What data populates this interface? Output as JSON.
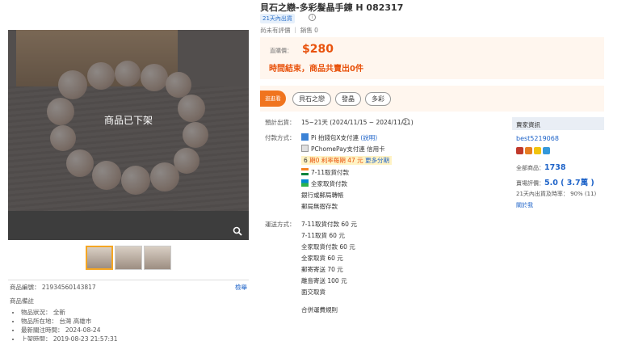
{
  "product": {
    "title": "貝石之戀-多彩髮晶手鍊 H 082317",
    "badge": "21天內出貨",
    "ratings": "尚未有評價 ｜ 銷售 0",
    "price_label": "直購價：",
    "price": "$280",
    "ended": "時間結束，商品共賣出0件"
  },
  "image": {
    "offline_text": "商品已下架"
  },
  "tags": {
    "flag": "逛逛看",
    "items": [
      "貝石之戀",
      "發晶",
      "多彩"
    ]
  },
  "shipping": {
    "label": "預計出貨：",
    "value": "15~21天 (2024/11/15 ~ 2024/11/21)"
  },
  "payment": {
    "label": "付款方式：",
    "rows": [
      "Pi 拍錢包X支付連 (說明)",
      "PChomePay支付連 信用卡",
      "6 期0 利率每期 47 元 更多分期",
      "7-11取貨付款",
      "全家取貨付款",
      "銀行或郵局轉帳",
      "郵局無摺存款"
    ],
    "link_explain": "(說明)",
    "inst_periods": "6",
    "inst_zero": "期0 利率每期",
    "inst_amount": "47 元",
    "inst_more": "更多分期"
  },
  "delivery": {
    "label": "運送方式：",
    "rows": [
      "7-11取貨付款 60 元",
      "7-11取貨 60 元",
      "全家取貨付款 60 元",
      "全家取貨 60 元",
      "郵寄寄送 70 元",
      "離島寄送 100 元",
      "面交取貨"
    ],
    "rule_link": "合併運費規則"
  },
  "seller": {
    "header": "賣家資訊",
    "name": "best5219068",
    "items_label": "全部商品：",
    "items_count": "1738",
    "rating_label": "賣場評價：",
    "rating_value": "5.0 ( 3.7萬 )",
    "ship_rate": "21天內出貨及時率： 90% (11)",
    "follow": "關於我"
  },
  "item_meta": {
    "number_label": "商品編號：",
    "number": "21934560143817",
    "report": "檢舉",
    "notes_header": "商品備註",
    "notes": [
      "物品狀況： 全新",
      "物品所在地： 台灣 高雄市",
      "最新關注時間： 2024-08-24",
      "上架時間： 2019-08-23 21:57:31"
    ]
  },
  "colors": {
    "accent_orange": "#e8520c",
    "link_blue": "#1e63c8",
    "panel_bg": "#fff6ee"
  }
}
